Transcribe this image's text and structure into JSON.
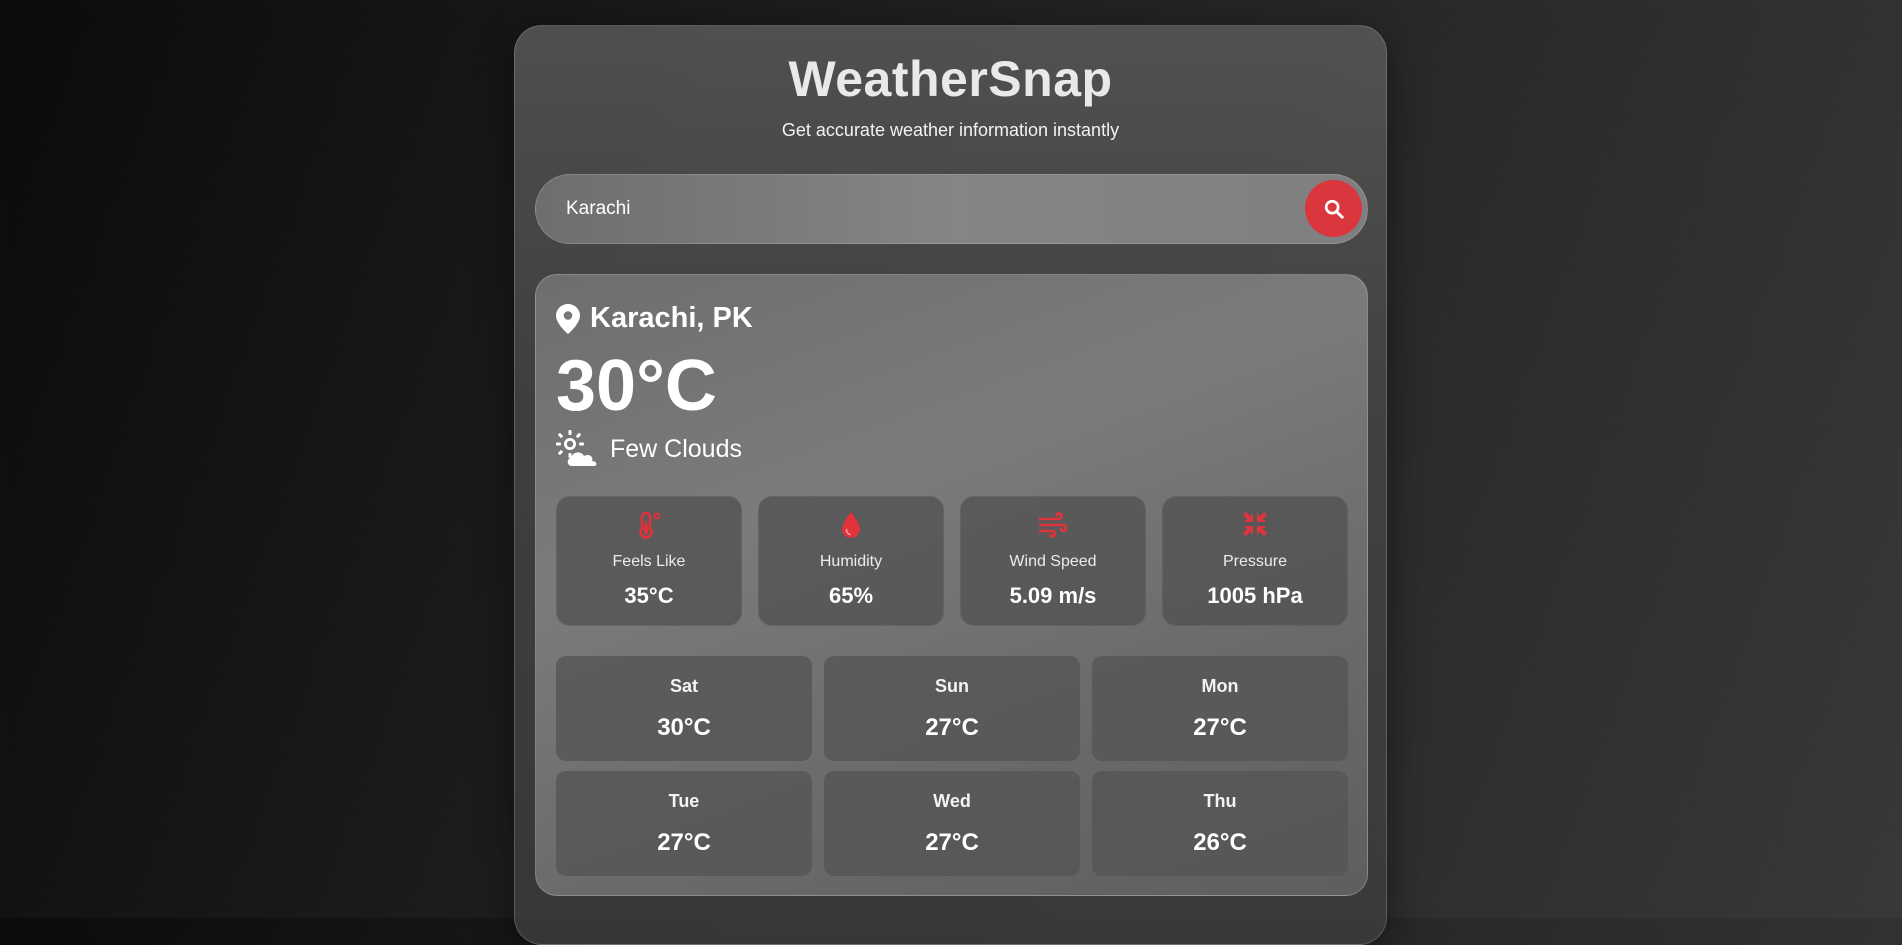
{
  "app": {
    "title": "WeatherSnap",
    "subtitle": "Get accurate weather information instantly"
  },
  "search": {
    "value": "Karachi",
    "button_icon": "search-icon"
  },
  "current": {
    "location": "Karachi, PK",
    "location_icon": "map-pin-icon",
    "temperature": "30°C",
    "condition": "Few Clouds",
    "condition_icon": "sun-cloud-icon"
  },
  "stats": [
    {
      "icon": "thermometer-icon",
      "label": "Feels Like",
      "value": "35°C"
    },
    {
      "icon": "droplet-icon",
      "label": "Humidity",
      "value": "65%"
    },
    {
      "icon": "wind-icon",
      "label": "Wind Speed",
      "value": "5.09 m/s"
    },
    {
      "icon": "compress-icon",
      "label": "Pressure",
      "value": "1005 hPa"
    }
  ],
  "forecast": [
    {
      "day": "Sat",
      "temp": "30°C"
    },
    {
      "day": "Sun",
      "temp": "27°C"
    },
    {
      "day": "Mon",
      "temp": "27°C"
    },
    {
      "day": "Tue",
      "temp": "27°C"
    },
    {
      "day": "Wed",
      "temp": "27°C"
    },
    {
      "day": "Thu",
      "temp": "26°C"
    }
  ],
  "colors": {
    "accent": "#d9363e",
    "icon_accent": "#e0333b"
  }
}
